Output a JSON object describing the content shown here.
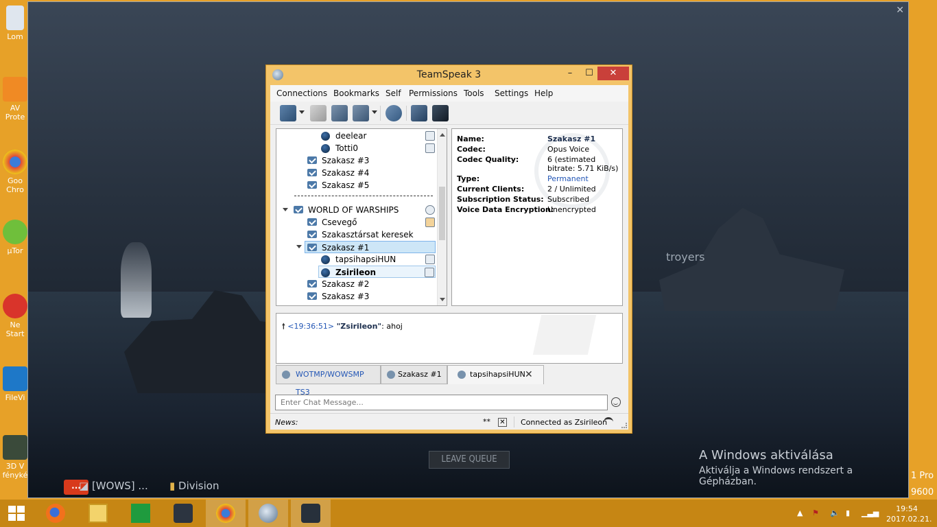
{
  "desktop": {
    "icons": [
      {
        "label": "Lom",
        "icon": "recycle-bin-icon"
      },
      {
        "label": "AV Prote",
        "icon": "antivirus-icon"
      },
      {
        "label": "Goo Chro",
        "icon": "chrome-icon"
      },
      {
        "label": "µTor",
        "icon": "utorrent-icon"
      },
      {
        "label": "Ne Start",
        "icon": "app-icon"
      },
      {
        "label": "FileVi",
        "icon": "fileviewer-icon"
      },
      {
        "label": "3D V fényké",
        "icon": "photo-viewer-icon"
      }
    ],
    "edge_text_1": "1 Pro",
    "edge_text_2": "9600"
  },
  "game": {
    "subtitle_fragment": "troyers",
    "leave_queue": "LEAVE QUEUE",
    "activation_title": "A Windows aktiválása",
    "activation_text": "Aktiválja a Windows rendszert a Gépházban.",
    "taskbar_items": [
      "[WOWS] ...",
      "Division"
    ]
  },
  "teamspeak": {
    "title": "TeamSpeak 3",
    "menu": [
      "Connections",
      "Bookmarks",
      "Self",
      "Permissions",
      "Tools",
      "Settings",
      "Help"
    ],
    "toolbar_icons": [
      "disconnect-icon",
      "away-icon",
      "mute-mic-icon",
      "mute-speakers-icon",
      "whisper-icon",
      "contacts-icon",
      "poke-icon"
    ],
    "tree": [
      {
        "type": "user",
        "name": "deelear",
        "indent": 2
      },
      {
        "type": "user",
        "name": "Totti0",
        "indent": 2
      },
      {
        "type": "channel",
        "name": "Szakasz #3",
        "indent": 1
      },
      {
        "type": "channel",
        "name": "Szakasz #4",
        "indent": 1
      },
      {
        "type": "channel",
        "name": "Szakasz #5",
        "indent": 1
      },
      {
        "type": "spacer",
        "name": ""
      },
      {
        "type": "channel",
        "name": "WORLD OF WARSHIPS",
        "indent": 0,
        "expanded": true
      },
      {
        "type": "channel",
        "name": "Csevegő",
        "indent": 1
      },
      {
        "type": "channel",
        "name": "Szakasztársat keresek",
        "indent": 1
      },
      {
        "type": "channel",
        "name": "Szakasz #1",
        "indent": 1,
        "expanded": true,
        "selected": true
      },
      {
        "type": "user",
        "name": "tapsihapsiHUN",
        "indent": 2
      },
      {
        "type": "user",
        "name": "Zsirileon",
        "indent": 2,
        "bold": true,
        "focused": true
      },
      {
        "type": "channel",
        "name": "Szakasz #2",
        "indent": 1
      },
      {
        "type": "channel",
        "name": "Szakasz #3",
        "indent": 1
      }
    ],
    "info": {
      "name_label": "Name:",
      "name": "Szakasz #1",
      "codec_label": "Codec:",
      "codec": "Opus Voice",
      "quality_label": "Codec Quality:",
      "quality_1": "6 (estimated",
      "quality_2": "bitrate: 5.71 KiB/s)",
      "type_label": "Type:",
      "type": "Permanent",
      "clients_label": "Current Clients:",
      "clients": "2 / Unlimited",
      "subscription_label": "Subscription Status:",
      "subscription": "Subscribed",
      "encryption_label": "Voice Data Encryption:",
      "encryption": "Unencrypted"
    },
    "chat": {
      "time": "<19:36:51>",
      "sender": "\"Zsirileon\"",
      "message": ": ahoj"
    },
    "tabs": [
      "WOTMP/WOWSMP TS3",
      "Szakasz #1",
      "tapsihapsiHUN"
    ],
    "input_placeholder": "Enter Chat Message...",
    "status": {
      "news_label": "News:",
      "stars": "**",
      "connected": "Connected as Zsirileon"
    }
  },
  "taskbar": {
    "apps": [
      "firefox-icon",
      "file-explorer-icon",
      "store-icon",
      "wows-icon",
      "chrome-icon",
      "teamspeak-icon",
      "wows-launcher-icon"
    ],
    "time": "19:54",
    "date": "2017.02.21."
  }
}
